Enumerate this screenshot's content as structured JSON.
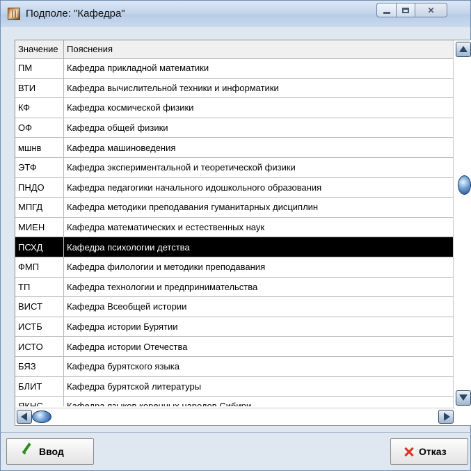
{
  "window": {
    "title": "Подполе: \"Кафедра\""
  },
  "table": {
    "columns": [
      "Значение",
      "Пояснения"
    ],
    "rows": [
      [
        "ПМ",
        "Кафедра прикладной математики"
      ],
      [
        "ВТИ",
        "Кафедра вычислительной техники и информатики"
      ],
      [
        "КФ",
        "Кафедра космической физики"
      ],
      [
        "ОФ",
        "Кафедра общей физики"
      ],
      [
        "мшнв",
        "Кафедра машиноведения"
      ],
      [
        "ЭТФ",
        "Кафедра экспериментальной и теоретической физики"
      ],
      [
        "ПНДО",
        "Кафедра педагогики начального идошкольного образования"
      ],
      [
        "МПГД",
        "Кафедра методики преподавания гуманитарных дисциплин"
      ],
      [
        "МИЕН",
        "Кафедра математических и естественных наук"
      ],
      [
        "ПСХД",
        "Кафедра психологии детства"
      ],
      [
        "ФМП",
        "Кафедра филологии и методики преподавания"
      ],
      [
        "ТП",
        "Кафедра технологии и предпринимательства"
      ],
      [
        "ВИСТ",
        "Кафедра Всеобщей истории"
      ],
      [
        "ИСТБ",
        "Кафедра истории Бурятии"
      ],
      [
        "ИСТО",
        "Кафедра истории Отечества"
      ],
      [
        "БЯЗ",
        "Кафедра бурятского языка"
      ],
      [
        "БЛИТ",
        "Кафедра бурятской литературы"
      ],
      [
        "ЯКНС",
        "Кафедра языков коренных народов Сибири"
      ]
    ],
    "selected_index": 9
  },
  "buttons": {
    "ok": "Ввод",
    "cancel": "Отказ"
  },
  "colors": {
    "selection_bg": "#000000",
    "selection_fg": "#ffffff",
    "cancel_icon": "#e0301e",
    "ok_icon": "#2e8a14"
  }
}
